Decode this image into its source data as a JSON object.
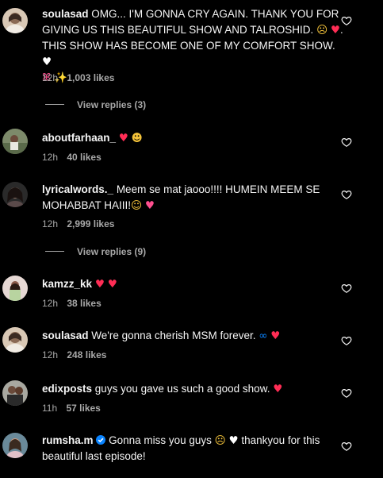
{
  "colors": {
    "background": "#000000",
    "text": "#f5f5f5",
    "meta": "#a8a8a8",
    "heart_red": "#ff2d55",
    "verified": "#0a84ff"
  },
  "comments": [
    {
      "username": "soulasad",
      "text": "OMG... I'M GONNA CRY AGAIN. THANK YOU FOR GIVING US THIS BEAUTIFUL SHOW AND TALROSHID.",
      "text_tail": ". THIS SHOW HAS BECOME ONE OF MY COMFORT SHOW.",
      "text_end": ".",
      "emojis": [
        "pleading-face",
        "red-heart",
        "white-heart",
        "butterfly",
        "sparkles"
      ],
      "time": "12h",
      "likes": "1,003 likes",
      "replies": "View replies (3)",
      "avatar_icon": "avatar-profile-photo",
      "like_icon": "heart-outline-icon"
    },
    {
      "username": "aboutfarhaan_",
      "text": "",
      "emojis": [
        "red-heart",
        "heart-eyes-face"
      ],
      "time": "12h",
      "likes": "40 likes",
      "avatar_icon": "avatar-profile-photo",
      "like_icon": "heart-outline-icon"
    },
    {
      "username": "lyricalwords._",
      "text": "Meem se mat jaooo!!!! HUMEIN MEEM SE MOHABBAT HAIII!",
      "emojis": [
        "face-holding-back-tears",
        "heart-with-arrow"
      ],
      "time": "12h",
      "likes": "2,999 likes",
      "replies": "View replies (9)",
      "avatar_icon": "avatar-profile-photo",
      "like_icon": "heart-outline-icon"
    },
    {
      "username": "kamzz_kk",
      "text": "",
      "emojis": [
        "red-heart",
        "red-heart"
      ],
      "time": "12h",
      "likes": "38 likes",
      "avatar_icon": "avatar-profile-photo",
      "like_icon": "heart-outline-icon"
    },
    {
      "username": "soulasad",
      "text": "We're gonna cherish MSM forever.",
      "emojis": [
        "infinity",
        "red-heart"
      ],
      "time": "12h",
      "likes": "248 likes",
      "avatar_icon": "avatar-profile-photo",
      "like_icon": "heart-outline-icon"
    },
    {
      "username": "edixposts",
      "text": "guys you gave us such a good show.",
      "emojis": [
        "red-heart"
      ],
      "time": "11h",
      "likes": "57 likes",
      "avatar_icon": "avatar-profile-photo",
      "like_icon": "heart-outline-icon"
    },
    {
      "username": "rumsha.m",
      "verified": true,
      "text": "Gonna miss you guys",
      "text_tail": "thankyou for this beautiful last episode!",
      "emojis": [
        "pleading-face",
        "white-heart"
      ],
      "time": "",
      "likes": "",
      "avatar_icon": "avatar-profile-photo",
      "like_icon": "heart-outline-icon"
    }
  ]
}
